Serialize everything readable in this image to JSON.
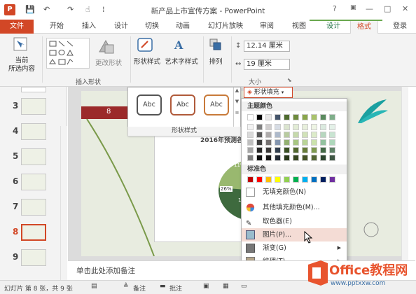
{
  "window": {
    "title": "新产品上市宣传方案 - PowerPoint",
    "app_icon": "P",
    "help": "?",
    "minimize": "—",
    "restore": "□",
    "close": "✕",
    "qat": {
      "save": "💾",
      "undo": "↶",
      "redo": "↷",
      "touch": "☝",
      "more": "⁞"
    }
  },
  "tabs": {
    "file": "文件",
    "home": "开始",
    "insert": "插入",
    "design": "设计",
    "transitions": "切换",
    "animations": "动画",
    "slideshow": "幻灯片放映",
    "review": "审阅",
    "view": "视图",
    "ctx_design": "设计",
    "ctx_format": "格式",
    "login": "登录"
  },
  "ribbon": {
    "current_selection": "当前",
    "current_selection2": "所选内容",
    "change_shape": "更改形状",
    "insert_shapes_group": "插入形状",
    "shape_styles": "形状样式",
    "wordart_styles": "艺术字样式",
    "arrange": "排列",
    "size_group": "大小",
    "height": "12.14 厘米",
    "width": "19 厘米"
  },
  "slides": {
    "numbers": [
      "3",
      "4",
      "5",
      "6",
      "7",
      "8",
      "9"
    ],
    "selected": "8"
  },
  "slide": {
    "label_8": "8",
    "chart_title": "2016年预测各",
    "pct_a": "26%",
    "pct_b": "11%",
    "pct_c": "17"
  },
  "gallery": {
    "items": [
      "Abc",
      "Abc",
      "Abc"
    ],
    "footer": "形状样式"
  },
  "fill_button": "形状填充",
  "dropdown": {
    "theme_colors": "主题颜色",
    "standard_colors": "标准色",
    "no_fill": "无填充颜色(N)",
    "more_colors": "其他填充颜色(M)...",
    "eyedropper": "取色器(E)",
    "picture": "图片(P)...",
    "gradient": "渐变(G)",
    "texture": "纹理(T)",
    "theme_rows": [
      [
        "#ffffff",
        "#000000",
        "#e7e6e6",
        "#44546a",
        "#4e6b2e",
        "#6e8b3d",
        "#8aa64b",
        "#a9c36b",
        "#5a8a5e",
        "#7fae8a"
      ],
      [
        "#f2f2f2",
        "#7f7f7f",
        "#d0cece",
        "#d6dce4",
        "#dbe5cf",
        "#e2ecd5",
        "#e8f0dc",
        "#eef5e4",
        "#dbeadf",
        "#e4f1e8"
      ],
      [
        "#d9d9d9",
        "#595959",
        "#aeabab",
        "#adb9ca",
        "#b8cba0",
        "#c5d9ab",
        "#d1e2b9",
        "#dcebc9",
        "#b7d6bf",
        "#c9e4d2"
      ],
      [
        "#bfbfbf",
        "#3f3f3f",
        "#757171",
        "#8496b0",
        "#94b171",
        "#a8c682",
        "#bad497",
        "#cbe2ac",
        "#93c19f",
        "#aed7bb"
      ],
      [
        "#a6a6a6",
        "#262626",
        "#3a3838",
        "#323f4f",
        "#3a5023",
        "#52682e",
        "#677c38",
        "#7e9a4f",
        "#436846",
        "#5f8267"
      ],
      [
        "#7f7f7f",
        "#0c0c0c",
        "#171616",
        "#222a35",
        "#273617",
        "#36461f",
        "#455325",
        "#546735",
        "#2d452f",
        "#3f5745"
      ]
    ],
    "std_colors": [
      "#c00000",
      "#ff0000",
      "#ffc000",
      "#ffff00",
      "#92d050",
      "#00b050",
      "#00b0f0",
      "#0070c0",
      "#002060",
      "#7030a0"
    ]
  },
  "notes": {
    "placeholder": "单击此处添加备注"
  },
  "status": {
    "slide_info": "幻灯片 第 8 张，共 9 张",
    "notes_btn": "备注",
    "comments_btn": "批注"
  },
  "watermark": {
    "brand": "Office教程网",
    "url": "www.pptxxw.com"
  },
  "colors": {
    "accent": "#d24726",
    "context_green": "#217346",
    "slide_bg": "#e8ece0"
  }
}
